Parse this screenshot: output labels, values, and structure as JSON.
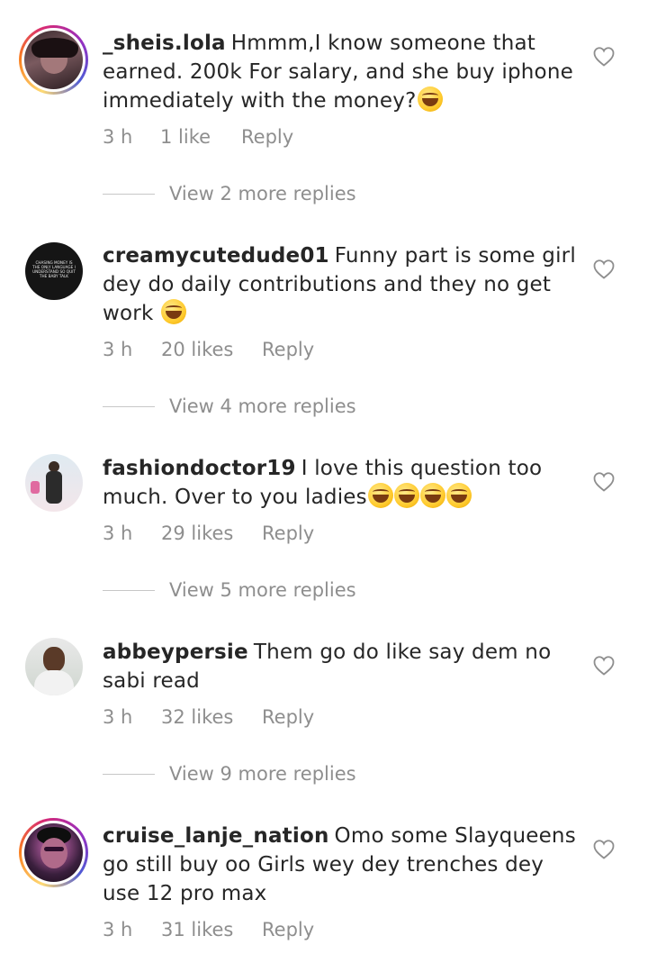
{
  "comments": [
    {
      "username": "_sheis.lola",
      "text": "Hmmm,I know someone that earned. 200k For salary, and she buy iphone immediately with the money?",
      "emojis": 1,
      "time": "3 h",
      "likes": "1 like",
      "reply": "Reply",
      "view_replies": "View 2 more replies"
    },
    {
      "username": "creamycutedude01",
      "text": "Funny part is some girl dey do daily contributions and they no get work",
      "emojis": 1,
      "time": "3 h",
      "likes": "20 likes",
      "reply": "Reply",
      "view_replies": "View 4 more replies"
    },
    {
      "username": "fashiondoctor19",
      "text": "I love this question too much. Over to you ladies",
      "emojis": 4,
      "time": "3 h",
      "likes": "29 likes",
      "reply": "Reply",
      "view_replies": "View 5 more replies"
    },
    {
      "username": "abbeypersie",
      "text": "Them go do like say dem no sabi read",
      "emojis": 0,
      "time": "3 h",
      "likes": "32 likes",
      "reply": "Reply",
      "view_replies": "View 9 more replies"
    },
    {
      "username": "cruise_lanje_nation",
      "text": "Omo some Slayqueens go still buy oo Girls wey dey trenches dey use 12 pro max",
      "emojis": 0,
      "time": "3 h",
      "likes": "31 likes",
      "reply": "Reply"
    }
  ],
  "avatar_text": "CHASING MONEY IS THE ONLY LANGUAGE I UNDERSTAND SO QUIT THE BABY TALK"
}
